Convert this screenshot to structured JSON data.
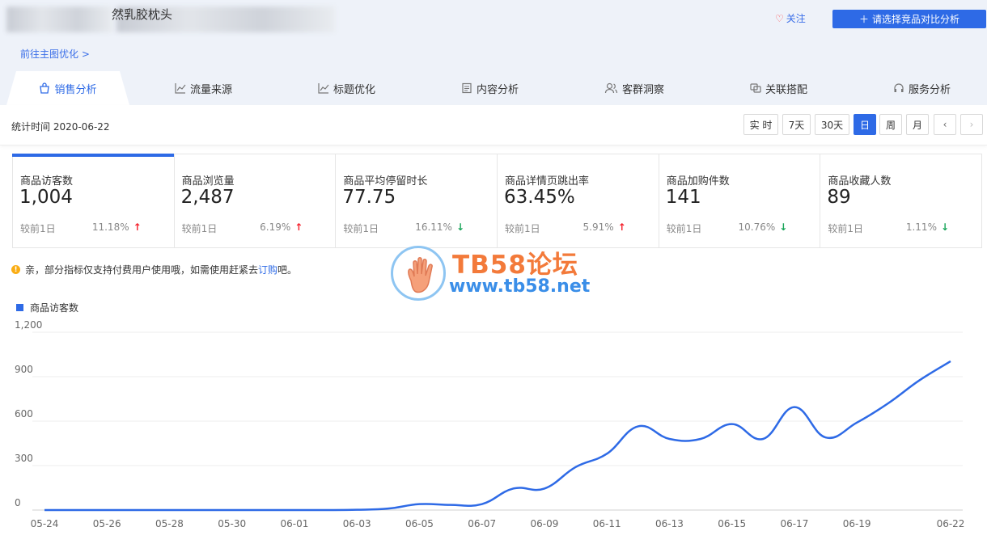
{
  "header": {
    "product_name": "然乳胶枕头",
    "follow_label": "关注",
    "compare_label": "请选择竞品对比分析",
    "goto_link": "前往主图优化 >"
  },
  "tabs": [
    {
      "label": "销售分析",
      "icon": "bag-icon",
      "active": true
    },
    {
      "label": "流量来源",
      "icon": "trend-icon"
    },
    {
      "label": "标题优化",
      "icon": "trend-icon"
    },
    {
      "label": "内容分析",
      "icon": "document-icon"
    },
    {
      "label": "客群洞察",
      "icon": "users-icon"
    },
    {
      "label": "关联搭配",
      "icon": "link-icon"
    },
    {
      "label": "服务分析",
      "icon": "headset-icon"
    }
  ],
  "time": {
    "label": "统计时间 2020-06-22",
    "periods": [
      "实 时",
      "7天",
      "30天",
      "日",
      "周",
      "月"
    ],
    "active_period": "日"
  },
  "kpis": [
    {
      "name": "商品访客数",
      "value": "1,004",
      "compare": "较前1日",
      "change": "11.18%",
      "dir": "up"
    },
    {
      "name": "商品浏览量",
      "value": "2,487",
      "compare": "较前1日",
      "change": "6.19%",
      "dir": "up"
    },
    {
      "name": "商品平均停留时长",
      "value": "77.75",
      "compare": "较前1日",
      "change": "16.11%",
      "dir": "down"
    },
    {
      "name": "商品详情页跳出率",
      "value": "63.45%",
      "compare": "较前1日",
      "change": "5.91%",
      "dir": "up"
    },
    {
      "name": "商品加购件数",
      "value": "141",
      "compare": "较前1日",
      "change": "10.76%",
      "dir": "down"
    },
    {
      "name": "商品收藏人数",
      "value": "89",
      "compare": "较前1日",
      "change": "1.11%",
      "dir": "down"
    }
  ],
  "notice": {
    "text_before": "亲，部分指标仅支持付费用户使用哦，如需使用赶紧去",
    "link": "订购",
    "text_after": "吧。"
  },
  "watermark": {
    "title": "TB58论坛",
    "url": "www.tb58.net"
  },
  "colors": {
    "accent": "#2e6ae6",
    "up": "#f5222d",
    "down": "#19a55a",
    "band": "#eef2f9"
  },
  "chart_data": {
    "type": "line",
    "legend": "商品访客数",
    "ylim": [
      0,
      1200
    ],
    "yticks": [
      0,
      300,
      600,
      900,
      1200
    ],
    "ytick_labels": [
      "0",
      "300",
      "600",
      "900",
      "1,200"
    ],
    "x": [
      "05-24",
      "05-25",
      "05-26",
      "05-27",
      "05-28",
      "05-29",
      "05-30",
      "05-31",
      "06-01",
      "06-02",
      "06-03",
      "06-04",
      "06-05",
      "06-06",
      "06-07",
      "06-08",
      "06-09",
      "06-10",
      "06-11",
      "06-12",
      "06-13",
      "06-14",
      "06-15",
      "06-16",
      "06-17",
      "06-18",
      "06-19",
      "06-20",
      "06-21",
      "06-22"
    ],
    "xtick_labels": [
      "05-24",
      "05-26",
      "05-28",
      "05-30",
      "06-01",
      "06-03",
      "06-05",
      "06-07",
      "06-09",
      "06-11",
      "06-13",
      "06-15",
      "06-17",
      "06-19",
      "06-22"
    ],
    "series": [
      {
        "name": "商品访客数",
        "values": [
          0,
          0,
          0,
          0,
          0,
          0,
          0,
          0,
          0,
          0,
          2,
          10,
          40,
          35,
          40,
          145,
          145,
          290,
          380,
          565,
          480,
          480,
          580,
          480,
          695,
          490,
          590,
          720,
          875,
          1004
        ]
      }
    ]
  }
}
